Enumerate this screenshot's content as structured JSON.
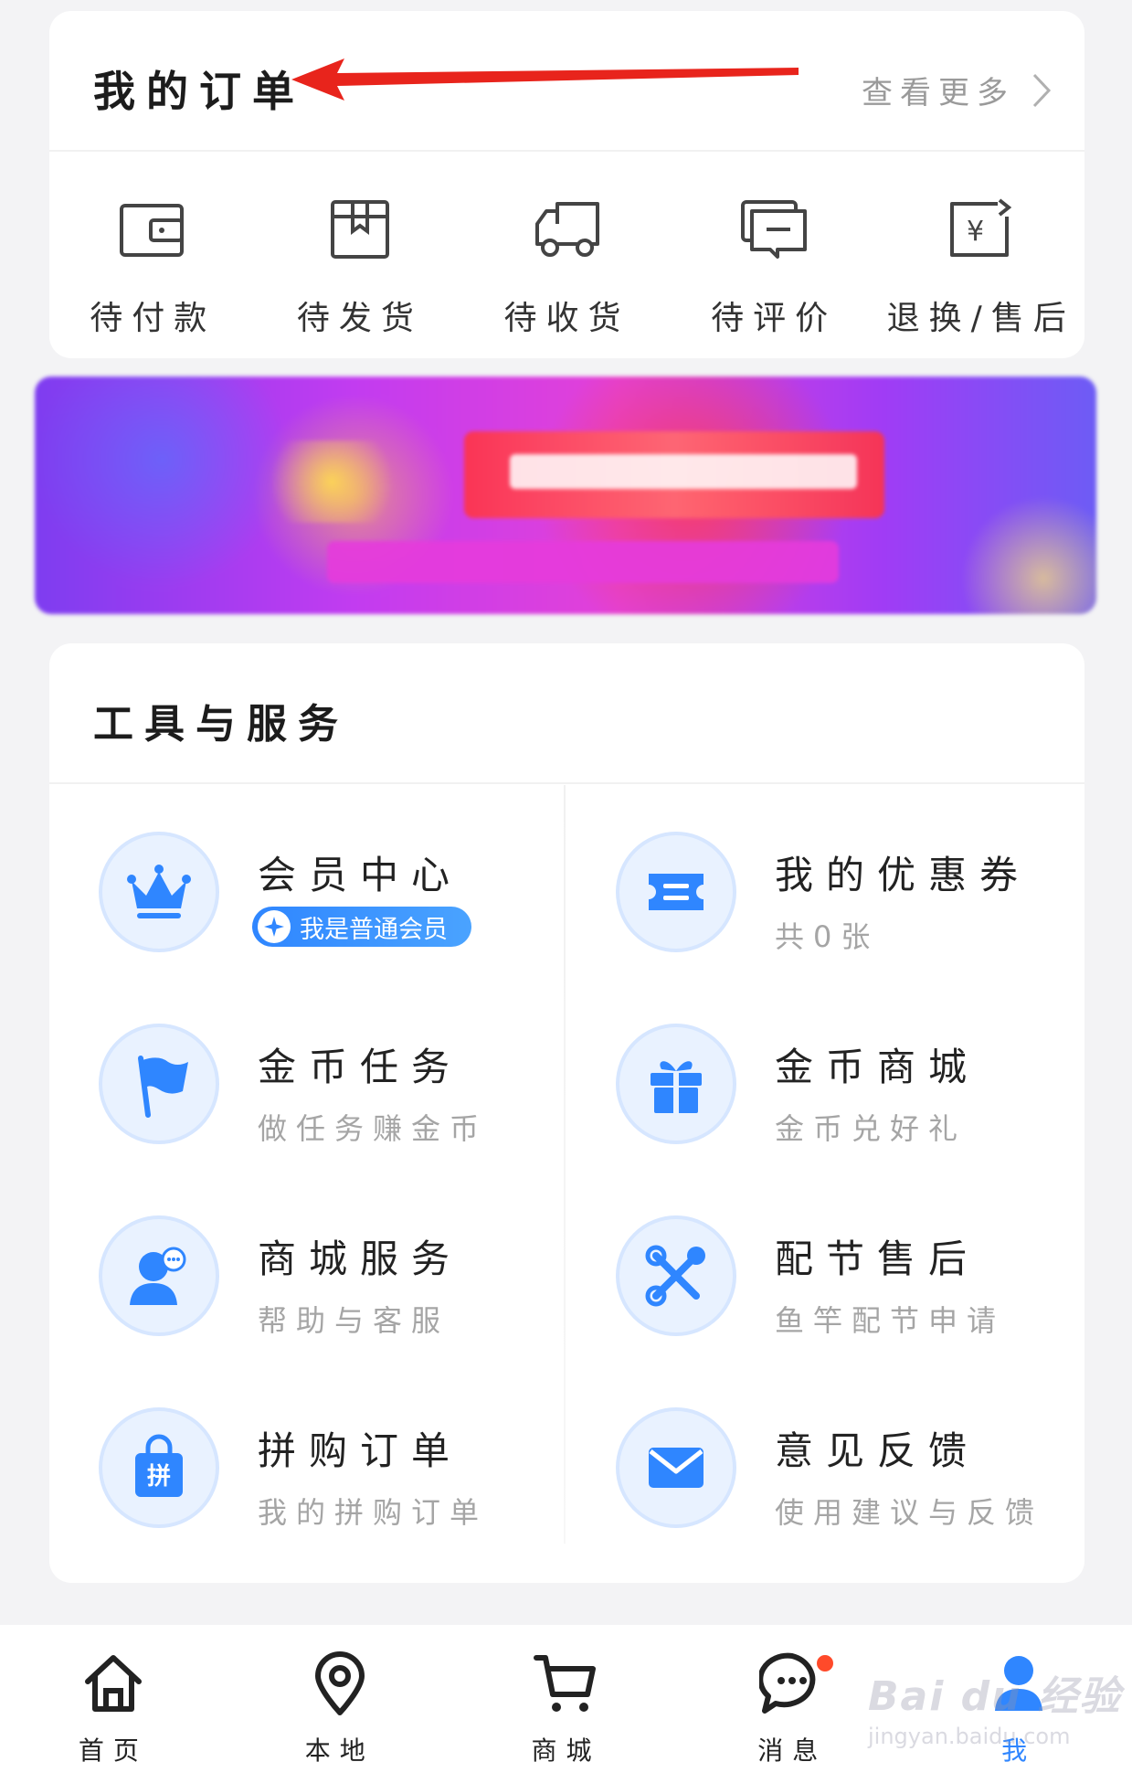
{
  "colors": {
    "accent": "#2f86ff",
    "icon_bg": "#e9f2ff",
    "arrow": "#e8241c",
    "notify": "#ff4a2a"
  },
  "orders": {
    "title": "我的订单",
    "view_more": "查看更多",
    "items": [
      {
        "label": "待付款",
        "icon": "wallet-icon"
      },
      {
        "label": "待发货",
        "icon": "package-icon"
      },
      {
        "label": "待收货",
        "icon": "truck-icon"
      },
      {
        "label": "待评价",
        "icon": "comment-icon"
      },
      {
        "label": "退换/售后",
        "icon": "refund-icon"
      }
    ]
  },
  "tools": {
    "title": "工具与服务",
    "items": [
      {
        "title": "会员中心",
        "badge": "我是普通会员",
        "icon": "crown-icon"
      },
      {
        "title": "我的优惠券",
        "subtitle": "共0张",
        "icon": "coupon-icon"
      },
      {
        "title": "金币任务",
        "subtitle": "做任务赚金币",
        "icon": "flag-icon"
      },
      {
        "title": "金币商城",
        "subtitle": "金币兑好礼",
        "icon": "gift-icon"
      },
      {
        "title": "商城服务",
        "subtitle": "帮助与客服",
        "icon": "customer-service-icon"
      },
      {
        "title": "配节售后",
        "subtitle": "鱼竿配节申请",
        "icon": "tools-icon"
      },
      {
        "title": "拼购订单",
        "subtitle": "我的拼购订单",
        "icon": "group-buy-icon",
        "icon_text": "拼"
      },
      {
        "title": "意见反馈",
        "subtitle": "使用建议与反馈",
        "icon": "mail-icon"
      }
    ]
  },
  "nav": {
    "items": [
      {
        "label": "首页",
        "icon": "home-icon"
      },
      {
        "label": "本地",
        "icon": "location-icon"
      },
      {
        "label": "商城",
        "icon": "cart-icon"
      },
      {
        "label": "消息",
        "icon": "message-icon"
      },
      {
        "label": "我",
        "icon": "profile-icon",
        "active": true
      }
    ]
  },
  "watermark": {
    "brand": "Bai du 经验",
    "url": "jingyan.baidu.com"
  }
}
